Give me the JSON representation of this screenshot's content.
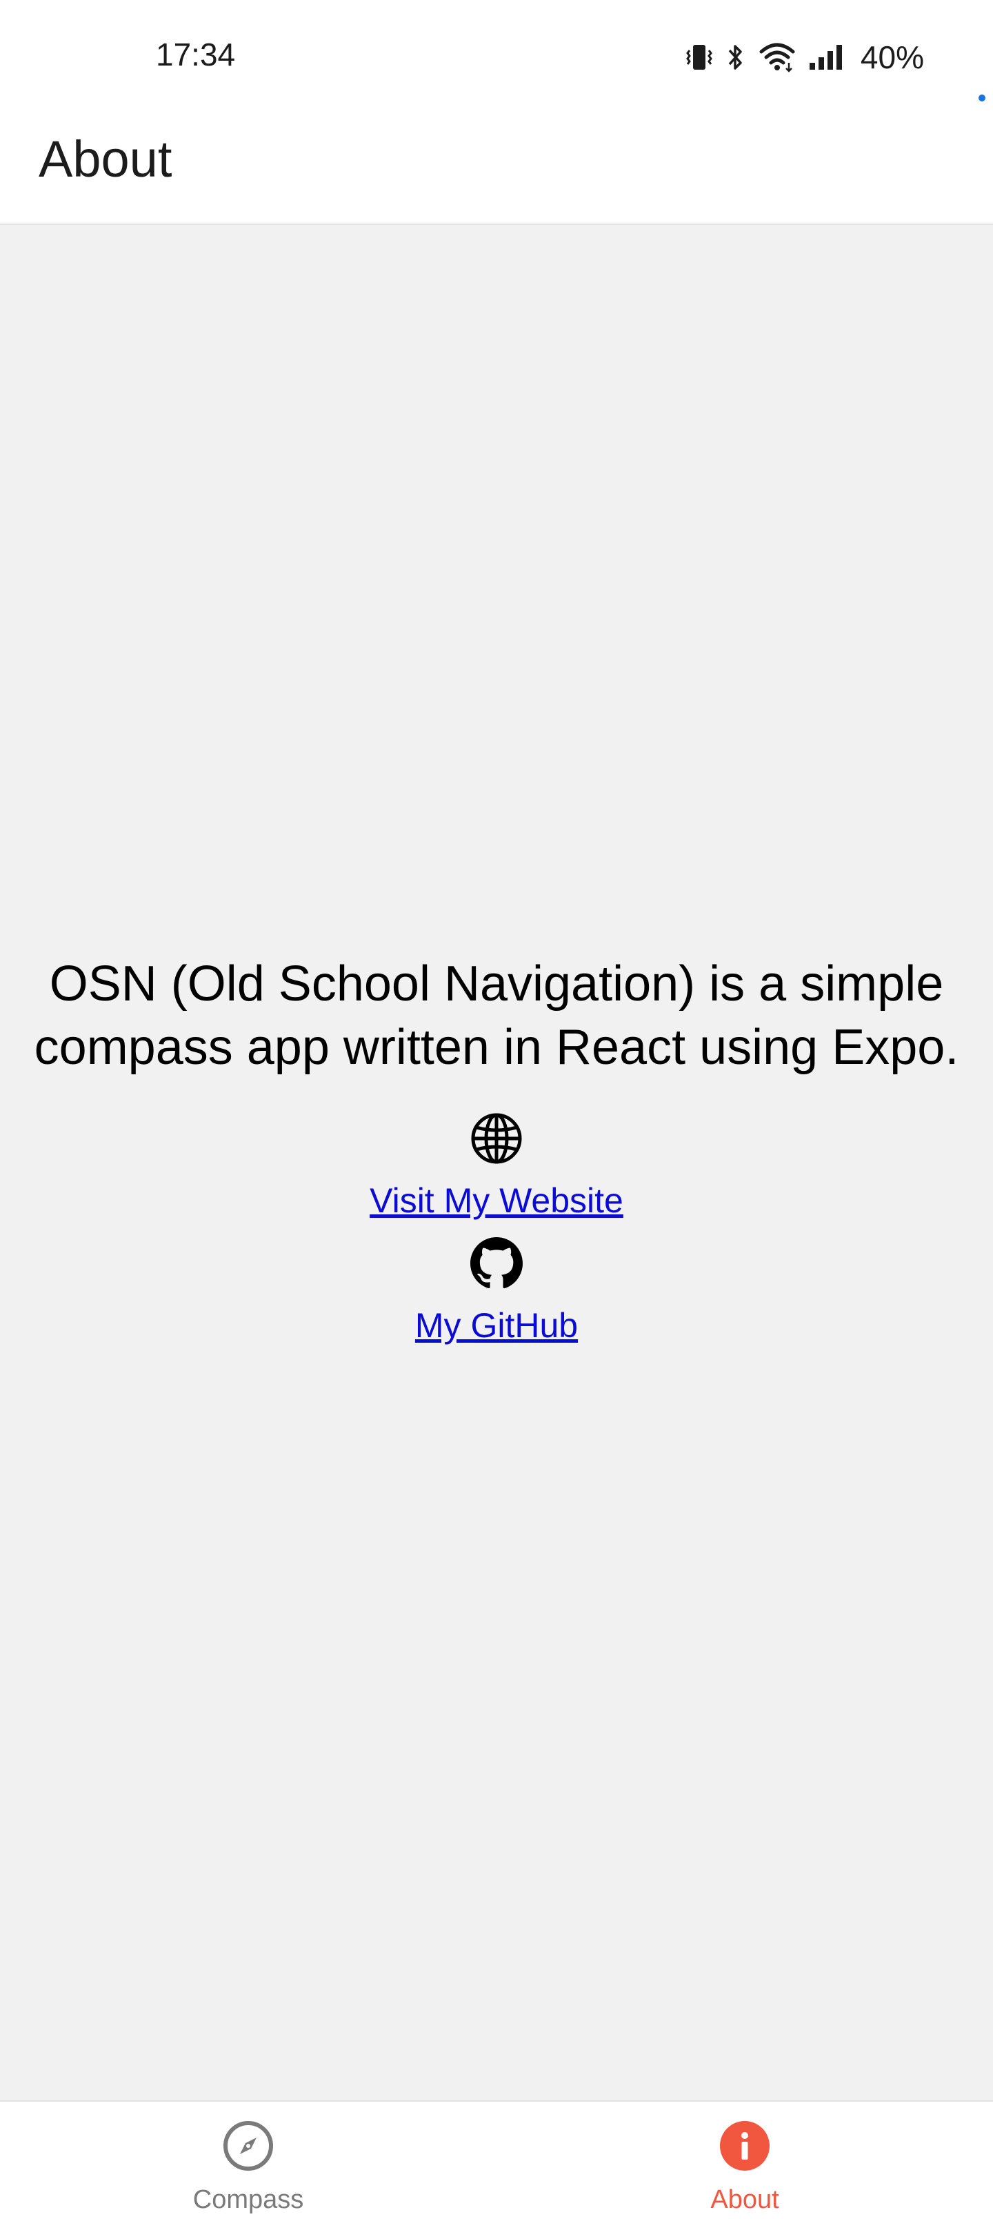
{
  "status_bar": {
    "time": "17:34",
    "battery": "40%",
    "icons": [
      "vibrate-icon",
      "bluetooth-icon",
      "wifi-icon",
      "signal-icon"
    ]
  },
  "header": {
    "title": "About"
  },
  "main": {
    "description": "OSN (Old School Navigation) is a simple compass app written in React using Expo.",
    "website_link": "Visit My Website",
    "github_link": "My GitHub"
  },
  "tabs": [
    {
      "label": "Compass",
      "icon": "compass-icon",
      "active": false
    },
    {
      "label": "About",
      "icon": "info-icon",
      "active": true
    }
  ],
  "colors": {
    "accent": "#f1573f",
    "link": "#0b0bd6",
    "inactive_tab": "#7a7a7a",
    "background": "#f1f1f1"
  }
}
